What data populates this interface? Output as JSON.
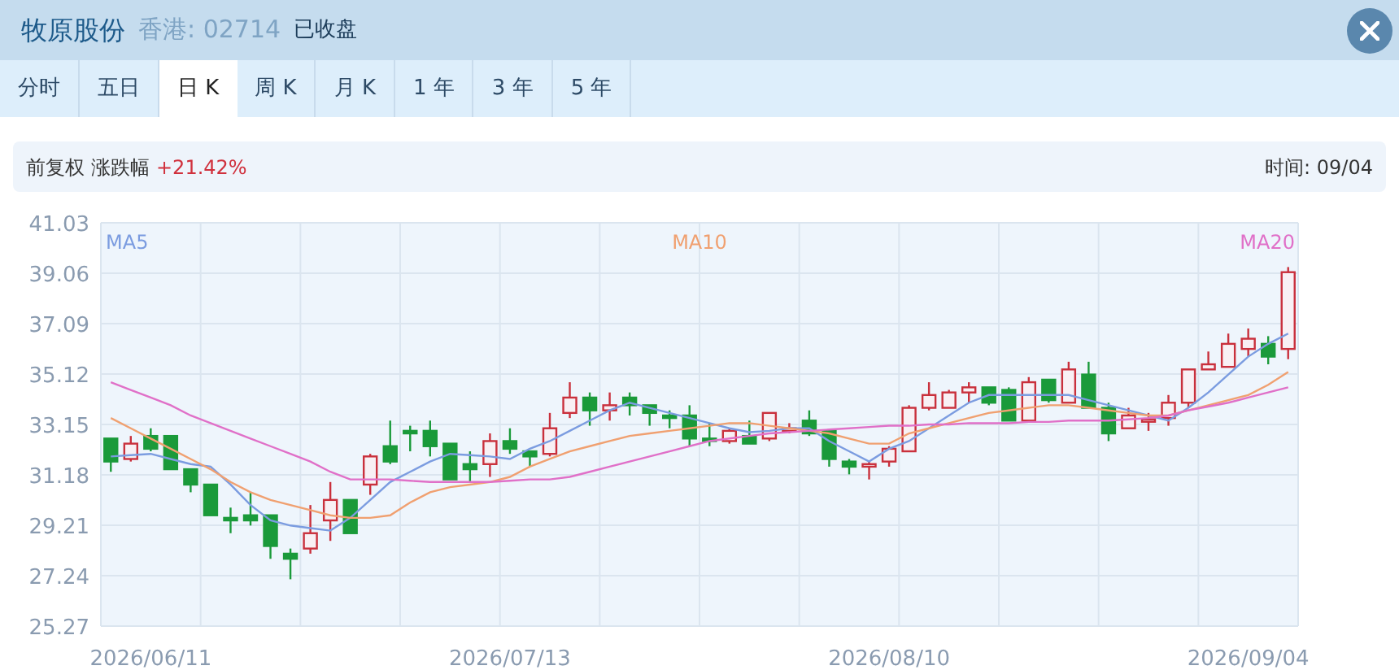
{
  "header": {
    "name": "牧原股份",
    "market": "香港: 02714",
    "status": "已收盘"
  },
  "tabs": [
    {
      "label": "分时",
      "selected": false
    },
    {
      "label": "五日",
      "selected": false
    },
    {
      "label": "日 K",
      "selected": true
    },
    {
      "label": "周 K",
      "selected": false
    },
    {
      "label": "月 K",
      "selected": false
    },
    {
      "label": "1 年",
      "selected": false
    },
    {
      "label": "3 年",
      "selected": false
    },
    {
      "label": "5 年",
      "selected": false
    }
  ],
  "info": {
    "adjust": "前复权",
    "change_label": "涨跌幅",
    "change": "+21.42%",
    "time": "时间: 09/04"
  },
  "chart": {
    "chart_data": {
      "type": "candlestick",
      "grid": true,
      "categories": [
        null,
        null,
        "2026/06/11",
        null,
        null,
        null,
        null,
        null,
        null,
        null,
        null,
        null,
        null,
        null,
        null,
        null,
        null,
        null,
        null,
        null,
        "2026/07/13",
        null,
        null,
        null,
        null,
        null,
        null,
        null,
        null,
        null,
        null,
        null,
        null,
        null,
        null,
        null,
        null,
        null,
        null,
        "2026/08/10",
        null,
        null,
        null,
        null,
        null,
        null,
        null,
        null,
        null,
        null,
        null,
        null,
        null,
        null,
        null,
        null,
        null,
        "2026/09/04",
        null,
        null
      ],
      "ylim": [
        25.27,
        41.03
      ],
      "yticks": [
        {
          "value": 41.03,
          "label": "41.03"
        },
        {
          "value": 39.06,
          "label": "39.06"
        },
        {
          "value": 37.09,
          "label": "37.09"
        },
        {
          "value": 35.12,
          "label": "35.12"
        },
        {
          "value": 33.15,
          "label": "33.15"
        },
        {
          "value": 31.18,
          "label": "31.18"
        },
        {
          "value": 29.21,
          "label": "29.21"
        },
        {
          "value": 27.24,
          "label": "27.24"
        },
        {
          "value": 25.27,
          "label": "25.27"
        }
      ],
      "ohlc": [
        [
          32.6,
          32.6,
          31.3,
          31.7
        ],
        [
          31.8,
          32.7,
          31.7,
          32.4
        ],
        [
          32.7,
          33.0,
          32.1,
          32.2
        ],
        [
          32.7,
          32.7,
          31.4,
          31.4
        ],
        [
          31.4,
          31.4,
          30.5,
          30.8
        ],
        [
          30.8,
          30.8,
          29.6,
          29.6
        ],
        [
          29.5,
          29.9,
          28.9,
          29.4
        ],
        [
          29.6,
          30.5,
          29.2,
          29.4
        ],
        [
          29.6,
          29.6,
          27.9,
          28.4
        ],
        [
          28.1,
          28.3,
          27.1,
          27.9
        ],
        [
          28.3,
          30.0,
          28.1,
          28.9
        ],
        [
          29.4,
          30.9,
          28.6,
          30.2
        ],
        [
          30.2,
          30.2,
          28.9,
          28.9
        ],
        [
          30.8,
          32.0,
          30.4,
          31.9
        ],
        [
          32.3,
          33.3,
          31.6,
          31.7
        ],
        [
          32.9,
          33.1,
          32.1,
          32.8
        ],
        [
          32.9,
          33.3,
          31.9,
          32.3
        ],
        [
          32.4,
          32.4,
          31.0,
          31.0
        ],
        [
          31.6,
          32.1,
          30.9,
          31.4
        ],
        [
          31.6,
          32.8,
          31.1,
          32.5
        ],
        [
          32.5,
          33.0,
          32.0,
          32.2
        ],
        [
          32.1,
          32.1,
          31.5,
          31.9
        ],
        [
          32.0,
          33.6,
          31.9,
          33.0
        ],
        [
          33.6,
          34.8,
          33.4,
          34.2
        ],
        [
          34.2,
          34.4,
          33.1,
          33.7
        ],
        [
          33.7,
          34.4,
          33.3,
          33.9
        ],
        [
          34.2,
          34.4,
          33.5,
          33.9
        ],
        [
          33.9,
          33.9,
          33.1,
          33.6
        ],
        [
          33.5,
          33.7,
          33.0,
          33.4
        ],
        [
          33.5,
          33.9,
          32.3,
          32.6
        ],
        [
          32.6,
          33.2,
          32.3,
          32.5
        ],
        [
          32.5,
          33.0,
          32.4,
          32.9
        ],
        [
          32.7,
          33.3,
          32.4,
          32.4
        ],
        [
          32.6,
          33.6,
          32.5,
          33.6
        ],
        [
          32.9,
          33.2,
          32.8,
          33.0
        ],
        [
          33.3,
          33.7,
          32.7,
          32.8
        ],
        [
          32.9,
          32.9,
          31.5,
          31.8
        ],
        [
          31.7,
          31.8,
          31.2,
          31.5
        ],
        [
          31.5,
          31.7,
          31.0,
          31.6
        ],
        [
          31.7,
          32.3,
          31.5,
          32.2
        ],
        [
          32.1,
          33.9,
          32.1,
          33.8
        ],
        [
          33.8,
          34.8,
          33.7,
          34.3
        ],
        [
          33.8,
          34.5,
          33.8,
          34.4
        ],
        [
          34.4,
          34.8,
          34.0,
          34.6
        ],
        [
          34.6,
          34.6,
          33.9,
          34.0
        ],
        [
          34.5,
          34.6,
          33.3,
          33.3
        ],
        [
          33.3,
          35.0,
          33.3,
          34.8
        ],
        [
          34.9,
          34.9,
          34.0,
          34.1
        ],
        [
          34.0,
          35.6,
          34.0,
          35.3
        ],
        [
          35.1,
          35.6,
          33.8,
          33.8
        ],
        [
          33.8,
          34.0,
          32.5,
          32.8
        ],
        [
          33.0,
          33.8,
          33.0,
          33.5
        ],
        [
          33.3,
          33.6,
          32.9,
          33.35
        ],
        [
          33.4,
          34.3,
          33.1,
          34.0
        ],
        [
          34.0,
          35.3,
          33.8,
          35.3
        ],
        [
          35.3,
          36.0,
          35.3,
          35.5
        ],
        [
          35.4,
          36.7,
          35.4,
          36.3
        ],
        [
          36.1,
          36.9,
          35.8,
          36.5
        ],
        [
          36.3,
          36.6,
          35.5,
          35.8
        ],
        [
          36.1,
          39.3,
          35.7,
          39.1
        ]
      ],
      "series": [
        {
          "name": "MA5",
          "type": "line",
          "color": "#7b9ce0",
          "values": [
            31.9,
            31.95,
            32.0,
            31.8,
            31.6,
            31.5,
            30.8,
            30.0,
            29.4,
            29.2,
            29.1,
            29.0,
            29.5,
            30.2,
            30.9,
            31.3,
            31.7,
            32.0,
            31.95,
            31.9,
            31.8,
            32.2,
            32.5,
            32.9,
            33.3,
            33.7,
            34.0,
            33.8,
            33.6,
            33.4,
            33.2,
            33.0,
            32.85,
            32.9,
            33.0,
            33.0,
            32.5,
            32.1,
            31.7,
            32.2,
            32.5,
            33.0,
            33.5,
            34.0,
            34.3,
            34.3,
            34.3,
            34.3,
            34.3,
            34.1,
            33.9,
            33.7,
            33.5,
            33.3,
            33.8,
            34.4,
            35.1,
            35.8,
            36.3,
            36.7
          ]
        },
        {
          "name": "MA10",
          "type": "line",
          "color": "#f0a070",
          "values": [
            33.4,
            33.0,
            32.6,
            32.2,
            31.8,
            31.4,
            30.9,
            30.5,
            30.2,
            30.0,
            29.8,
            29.6,
            29.5,
            29.5,
            29.6,
            30.1,
            30.5,
            30.7,
            30.8,
            30.9,
            31.1,
            31.5,
            31.8,
            32.1,
            32.3,
            32.5,
            32.7,
            32.8,
            32.9,
            33.0,
            33.1,
            33.2,
            33.2,
            33.1,
            33.0,
            32.9,
            32.8,
            32.6,
            32.4,
            32.4,
            32.8,
            33.0,
            33.2,
            33.4,
            33.6,
            33.7,
            33.8,
            33.9,
            33.9,
            33.8,
            33.7,
            33.6,
            33.5,
            33.5,
            33.7,
            33.9,
            34.1,
            34.3,
            34.7,
            35.2
          ]
        },
        {
          "name": "MA20",
          "type": "line",
          "color": "#e070c8",
          "values": [
            34.8,
            34.5,
            34.2,
            33.9,
            33.5,
            33.2,
            32.9,
            32.6,
            32.3,
            32.0,
            31.7,
            31.3,
            31.0,
            31.0,
            31.0,
            30.95,
            30.9,
            30.9,
            30.9,
            30.9,
            30.95,
            31.0,
            31.0,
            31.1,
            31.3,
            31.5,
            31.7,
            31.9,
            32.1,
            32.3,
            32.5,
            32.6,
            32.7,
            32.8,
            32.85,
            32.9,
            32.95,
            33.0,
            33.05,
            33.1,
            33.1,
            33.15,
            33.15,
            33.2,
            33.2,
            33.2,
            33.25,
            33.25,
            33.3,
            33.3,
            33.3,
            33.35,
            33.4,
            33.5,
            33.7,
            33.85,
            34.0,
            34.2,
            34.4,
            34.6
          ]
        }
      ]
    }
  }
}
